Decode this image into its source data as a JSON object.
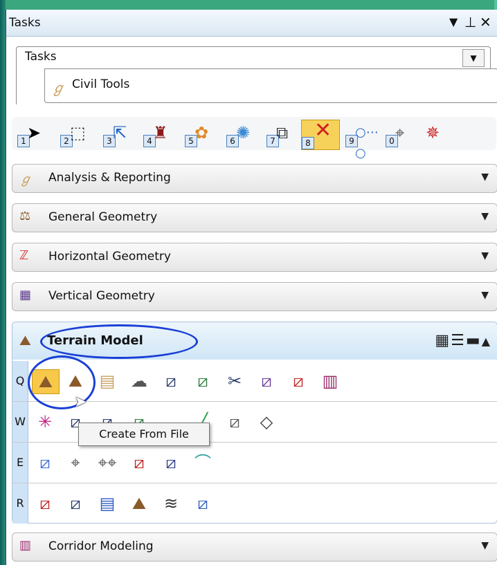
{
  "titlebar": {
    "title": "Tasks",
    "icons": [
      "dropdown-arrow-icon",
      "pin-icon",
      "close-icon"
    ]
  },
  "task_selector": {
    "value": "Tasks"
  },
  "civil_tools": {
    "label": "Civil Tools",
    "icon": "civil-tools-icon"
  },
  "toolbar": {
    "items": [
      {
        "key": "1",
        "icon": "select-arrow-icon"
      },
      {
        "key": "2",
        "icon": "selection-box-icon"
      },
      {
        "key": "3",
        "icon": "copy-element-icon"
      },
      {
        "key": "4",
        "icon": "paint-brush-icon"
      },
      {
        "key": "5",
        "icon": "palette-icon"
      },
      {
        "key": "6",
        "icon": "light-bulb-icon"
      },
      {
        "key": "7",
        "icon": "scale-icon"
      },
      {
        "key": "8",
        "icon": "delete-x-icon",
        "active": true
      },
      {
        "key": "9",
        "icon": "measure-distance-icon"
      },
      {
        "key": "0",
        "icon": "measure-point-icon"
      },
      {
        "key": "",
        "icon": "target-icon"
      }
    ]
  },
  "sections": [
    {
      "label": "Analysis & Reporting",
      "icon": "analysis-icon",
      "color": "#c8a060"
    },
    {
      "label": "General Geometry",
      "icon": "general-geometry-icon",
      "color": "#8b5a2b"
    },
    {
      "label": "Horizontal Geometry",
      "icon": "horizontal-geometry-icon",
      "color": "#d03030"
    },
    {
      "label": "Vertical Geometry",
      "icon": "vertical-geometry-icon",
      "color": "#5a3a8a"
    }
  ],
  "terrain": {
    "label": "Terrain Model",
    "icon": "terrain-model-icon",
    "rows": [
      {
        "key": "Q",
        "icons": [
          "create-from-file-icon",
          "create-from-elements-icon",
          "create-from-graphical-filter-icon",
          "create-clipped-terrain-icon",
          "create-complex-terrain-icon",
          "create-terrain-by-elements-icon",
          "clip-terrain-icon",
          "terrain-from-boundary-icon",
          "terrain-point-label-icon",
          "terrain-model-colored-icon"
        ]
      },
      {
        "key": "W",
        "icons": [
          "add-features-icon",
          "add-terrain-point-icon",
          "edit-terrain-icon",
          "add-breakline-icon",
          "line-icon",
          "terrain-check-icon",
          "boundary-icon"
        ]
      },
      {
        "key": "E",
        "icons": [
          "drape-terrain-icon",
          "single-point-icon",
          "double-point-icon",
          "terrain-highlight-icon",
          "terrain-blue-icon",
          "arc-terrain-icon"
        ]
      },
      {
        "key": "R",
        "icons": [
          "terrain-red-icon",
          "terrain-grid-icon",
          "terrain-report-icon",
          "export-terrain-icon",
          "contour-label-icon",
          "terrain-elevation-icon"
        ]
      }
    ]
  },
  "tooltip": {
    "text": "Create From File"
  },
  "corridor": {
    "label": "Corridor Modeling",
    "icon": "corridor-modeling-icon"
  },
  "colors": {
    "annotation_circle": "#1a3fd6",
    "active_tool": "#f7d25a",
    "background": "#3aa77e"
  }
}
